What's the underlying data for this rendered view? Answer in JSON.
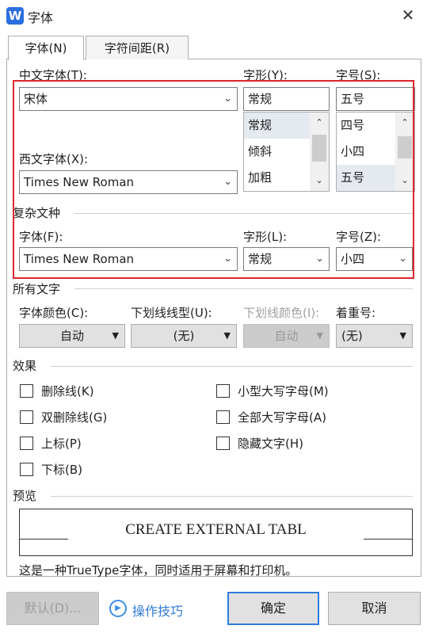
{
  "window": {
    "title": "字体",
    "app_icon_letter": "W"
  },
  "tabs": [
    {
      "label": "字体(N)"
    },
    {
      "label": "字符间距(R)"
    }
  ],
  "chinese_font": {
    "label": "中文字体(T):",
    "value": "宋体"
  },
  "style": {
    "label": "字形(Y):",
    "value": "常规",
    "options": [
      {
        "label": "常规",
        "selected": true
      },
      {
        "label": "倾斜"
      },
      {
        "label": "加粗"
      }
    ]
  },
  "size": {
    "label": "字号(S):",
    "value": "五号",
    "options": [
      {
        "label": "四号"
      },
      {
        "label": "小四"
      },
      {
        "label": "五号",
        "selected": true
      }
    ]
  },
  "western_font": {
    "label": "西文字体(X):",
    "value": "Times New Roman"
  },
  "complex_script": {
    "header": "复杂文种",
    "font_label": "字体(F):",
    "font_value": "Times New Roman",
    "style_label": "字形(L):",
    "style_value": "常规",
    "size_label": "字号(Z):",
    "size_value": "小四"
  },
  "all_text": {
    "header": "所有文字",
    "font_color_label": "字体颜色(C):",
    "font_color_value": "自动",
    "underline_type_label": "下划线线型(U):",
    "underline_type_value": "(无)",
    "underline_color_label": "下划线颜色(I):",
    "underline_color_value": "自动",
    "emphasis_label": "着重号:",
    "emphasis_value": "(无)"
  },
  "effects": {
    "header": "效果",
    "items": [
      {
        "label": "删除线(K)",
        "checked": false
      },
      {
        "label": "双删除线(G)",
        "checked": false
      },
      {
        "label": "上标(P)",
        "checked": false
      },
      {
        "label": "下标(B)",
        "checked": false
      },
      {
        "label": "小型大写字母(M)",
        "checked": false
      },
      {
        "label": "全部大写字母(A)",
        "checked": false
      },
      {
        "label": "隐藏文字(H)",
        "checked": false
      }
    ]
  },
  "preview": {
    "header": "预览",
    "sample_text": "CREATE EXTERNAL TABL",
    "note": "这是一种TrueType字体，同时适用于屏幕和打印机。"
  },
  "buttons": {
    "default_label": "默认(D)...",
    "tips_label": "操作技巧",
    "ok_label": "确定",
    "cancel_label": "取消"
  },
  "colors": {
    "accent": "#2f7bd9",
    "highlight_border": "#e0242e",
    "app_icon": "#2b6fe0"
  }
}
